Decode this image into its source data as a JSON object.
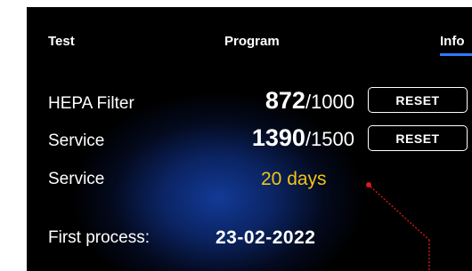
{
  "tabs": {
    "test": "Test",
    "program": "Program",
    "info": "Info"
  },
  "hepa": {
    "label": "HEPA Filter",
    "value": "872",
    "limit": "/1000",
    "reset": "RESET"
  },
  "service_hours": {
    "label": "Service",
    "value": "1390",
    "limit": "/1500",
    "reset": "RESET"
  },
  "service_days": {
    "label": "Service",
    "value": "20 days"
  },
  "first_process": {
    "label": "First process:",
    "value": "23-02-2022"
  },
  "colors": {
    "accent_blue": "#2f7bff",
    "days_yellow": "#f0c418",
    "annotation_red": "#e0181e"
  }
}
